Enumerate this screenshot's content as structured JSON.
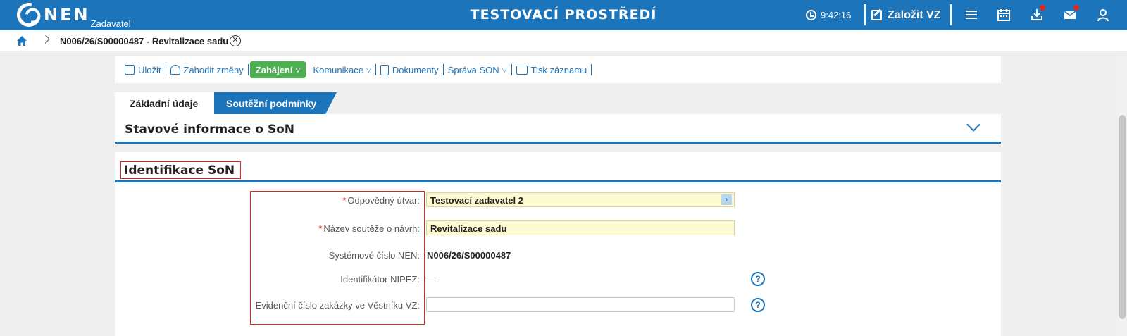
{
  "header": {
    "logo_text": "NEN",
    "logo_sub": "Zadavatel",
    "env_title": "TESTOVACÍ PROSTŘEDÍ",
    "time": "9:42:16",
    "create_label": "Založit VZ",
    "accent_color": "#1c74bb"
  },
  "breadcrumb": {
    "current": "N006/26/S00000487 - Revitalizace sadu"
  },
  "toolbar": {
    "save": "Uložit",
    "discard": "Zahodit změny",
    "start": "Zahájení",
    "communication": "Komunikace",
    "documents": "Dokumenty",
    "manage": "Správa SON",
    "print": "Tisk záznamu"
  },
  "tabs": [
    {
      "label": "Základní údaje",
      "active": true
    },
    {
      "label": "Soutěžní podmínky",
      "active": false
    }
  ],
  "status_panel": {
    "title": "Stavové informace o SoN"
  },
  "ident_panel": {
    "title": "Identifikace SoN",
    "fields": {
      "unit_label": "Odpovědný útvar:",
      "unit_value": "Testovací zadavatel 2",
      "name_label": "Název soutěže o návrh:",
      "name_value": "Revitalizace sadu",
      "sysnum_label": "Systémové číslo NEN:",
      "sysnum_value": "N006/26/S00000487",
      "nipez_label": "Identifikátor NIPEZ:",
      "nipez_value": "—",
      "evid_label": "Evidenční číslo zakázky ve Věstníku VZ:",
      "evid_value": ""
    }
  }
}
